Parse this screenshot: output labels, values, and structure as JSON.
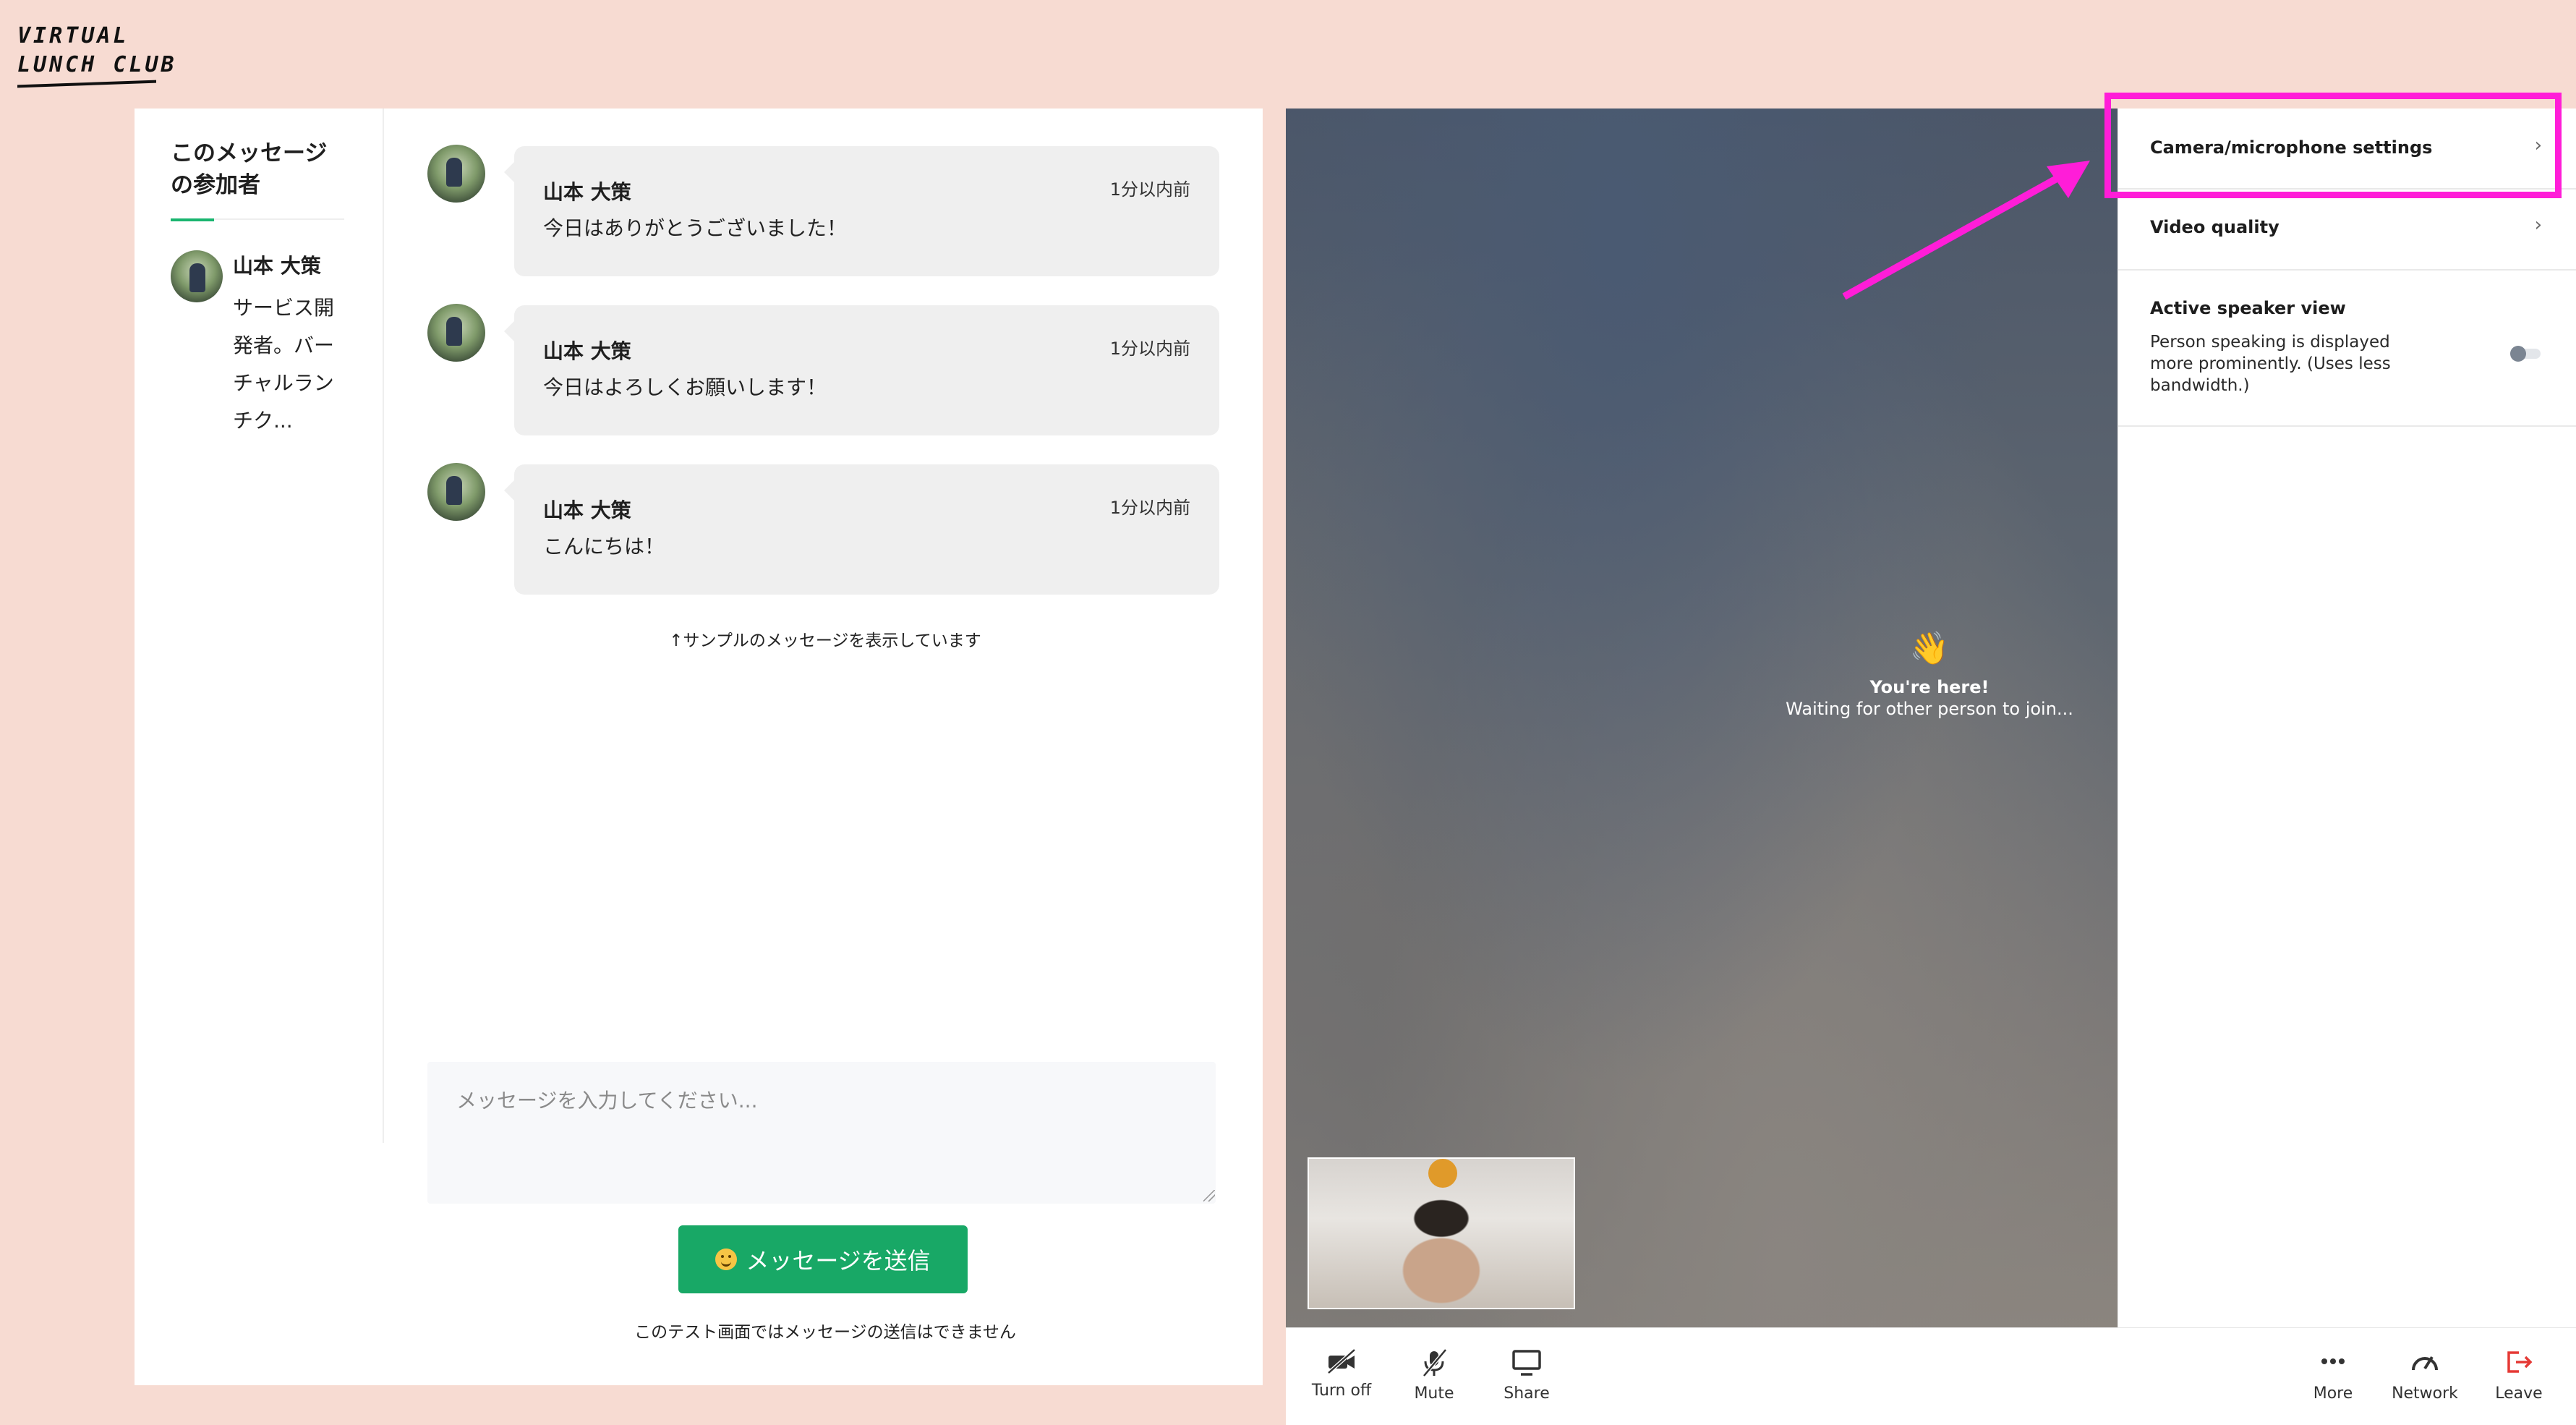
{
  "logo": {
    "line1": "VIRTUAL",
    "line2": "LUNCH CLUB"
  },
  "participants": {
    "heading": "このメッセージの参加者",
    "items": [
      {
        "name": "山本 大策",
        "bio": "サービス開発者。バーチャルランチク..."
      }
    ]
  },
  "messages": [
    {
      "name": "山本 大策",
      "time": "1分以内前",
      "text": "今日はありがとうございました！"
    },
    {
      "name": "山本 大策",
      "time": "1分以内前",
      "text": "今日はよろしくお願いします！"
    },
    {
      "name": "山本 大策",
      "time": "1分以内前",
      "text": "こんにちは！"
    }
  ],
  "sample_note": "↑サンプルのメッセージを表示しています",
  "composer": {
    "placeholder": "メッセージを入力してください...",
    "send_label": "メッセージを送信",
    "note": "このテスト画面ではメッセージの送信はできません"
  },
  "video": {
    "wave": "👋",
    "title": "You're here!",
    "subtitle": "Waiting for other person to join..."
  },
  "controls": {
    "turn_off": "Turn off",
    "mute": "Mute",
    "share": "Share",
    "more": "More",
    "network": "Network",
    "leave": "Leave"
  },
  "settings": {
    "camera_mic": "Camera/microphone settings",
    "video_quality": "Video quality",
    "active_speaker_title": "Active speaker view",
    "active_speaker_desc": "Person speaking is displayed more prominently. (Uses less bandwidth.)",
    "active_speaker_on": false,
    "chevron": "›"
  },
  "colors": {
    "page_bg": "#f7dbd2",
    "send_button": "#18a866",
    "highlight": "#ff1dd8",
    "leave": "#e53935"
  }
}
